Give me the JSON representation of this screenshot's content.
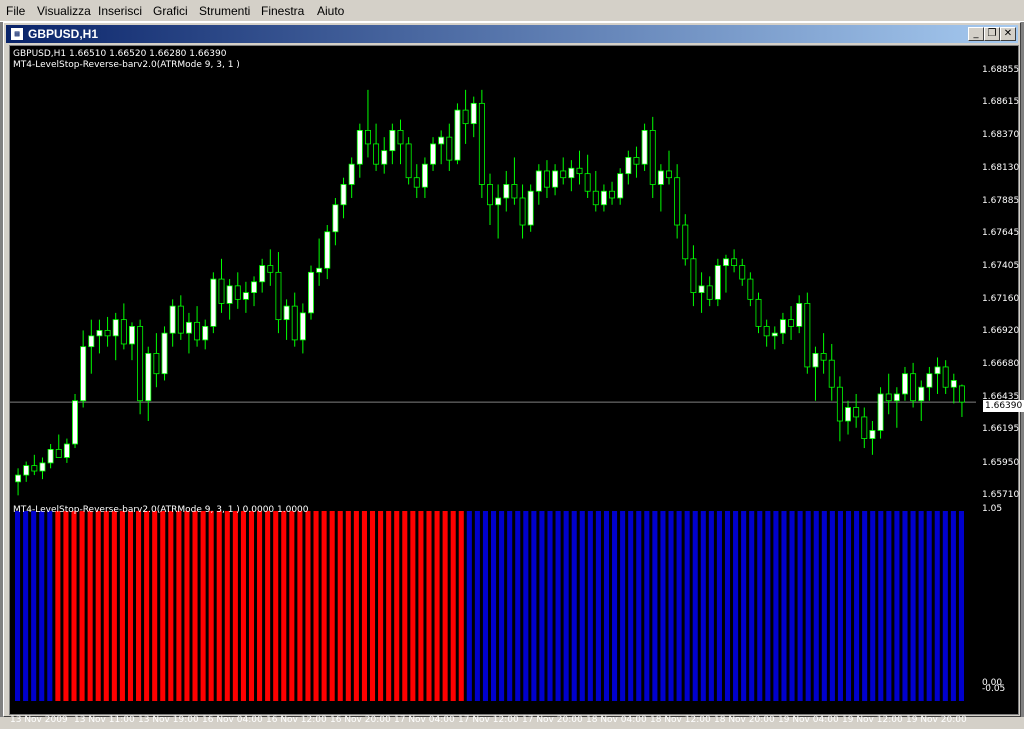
{
  "menu": {
    "items": [
      "File",
      "Visualizza",
      "Inserisci",
      "Grafici",
      "Strumenti",
      "Finestra",
      "Aiuto"
    ]
  },
  "window": {
    "title": "GBPUSD,H1",
    "icon": "chart-window-icon",
    "buttons": [
      "minimize-icon",
      "restore-icon",
      "close-icon"
    ]
  },
  "chart": {
    "symbol_info": "GBPUSD,H1  1.66510 1.66520 1.66280 1.66390",
    "indicator_label": "MT4-LevelStop-Reverse-barv2.0(ATRMode 9, 3, 1 )",
    "current_price": "1.66390",
    "price_ticks": [
      "1.68855",
      "1.68615",
      "1.68370",
      "1.68130",
      "1.67885",
      "1.67645",
      "1.67405",
      "1.67160",
      "1.66920",
      "1.66680",
      "1.66435",
      "1.66195",
      "1.65950",
      "1.65710"
    ],
    "time_ticks": [
      "13 Nov 2009",
      "13 Nov 11:00",
      "13 Nov 19:00",
      "16 Nov 04:00",
      "16 Nov 12:00",
      "16 Nov 20:00",
      "17 Nov 04:00",
      "17 Nov 12:00",
      "17 Nov 20:00",
      "18 Nov 04:00",
      "18 Nov 12:00",
      "18 Nov 20:00",
      "19 Nov 04:00",
      "19 Nov 12:00",
      "19 Nov 20:00"
    ],
    "colors": {
      "bull": "#ffffff",
      "wick": "#00ff00",
      "bear": "#000000",
      "grid_line": "#808080",
      "red_bar": "#ff0000",
      "blue_bar": "#0000cc"
    }
  },
  "indicator": {
    "label": "MT4-LevelStop-Reverse-barv2.0(ATRMode 9, 3, 1 ) 0.0000 1.0000",
    "axis_ticks": [
      "1.05",
      "0.00",
      "-0.05"
    ]
  },
  "chart_data": {
    "type": "candlestick",
    "symbol": "GBPUSD",
    "timeframe": "H1",
    "ylim": [
      1.6571,
      1.6898
    ],
    "last": 1.6639,
    "candles": [
      [
        1.658,
        1.659,
        1.657,
        1.6585
      ],
      [
        1.6585,
        1.6595,
        1.658,
        1.6592
      ],
      [
        1.6592,
        1.66,
        1.6585,
        1.6588
      ],
      [
        1.6588,
        1.6598,
        1.6582,
        1.6594
      ],
      [
        1.6594,
        1.6608,
        1.659,
        1.6604
      ],
      [
        1.6604,
        1.6615,
        1.66,
        1.6598
      ],
      [
        1.6598,
        1.6612,
        1.6594,
        1.6608
      ],
      [
        1.6608,
        1.6645,
        1.6605,
        1.664
      ],
      [
        1.664,
        1.6692,
        1.6635,
        1.668
      ],
      [
        1.668,
        1.67,
        1.666,
        1.6688
      ],
      [
        1.6688,
        1.67,
        1.6675,
        1.6692
      ],
      [
        1.6692,
        1.6702,
        1.668,
        1.6688
      ],
      [
        1.6688,
        1.6705,
        1.667,
        1.67
      ],
      [
        1.67,
        1.6712,
        1.6678,
        1.6682
      ],
      [
        1.6682,
        1.6698,
        1.667,
        1.6695
      ],
      [
        1.6695,
        1.67,
        1.663,
        1.664
      ],
      [
        1.664,
        1.668,
        1.6625,
        1.6675
      ],
      [
        1.6675,
        1.669,
        1.665,
        1.666
      ],
      [
        1.666,
        1.6695,
        1.6655,
        1.669
      ],
      [
        1.669,
        1.6715,
        1.668,
        1.671
      ],
      [
        1.671,
        1.6718,
        1.6685,
        1.669
      ],
      [
        1.669,
        1.6705,
        1.6675,
        1.6698
      ],
      [
        1.6698,
        1.671,
        1.668,
        1.6685
      ],
      [
        1.6685,
        1.67,
        1.6678,
        1.6695
      ],
      [
        1.6695,
        1.6735,
        1.669,
        1.673
      ],
      [
        1.673,
        1.6745,
        1.6705,
        1.6712
      ],
      [
        1.6712,
        1.673,
        1.67,
        1.6725
      ],
      [
        1.6725,
        1.6735,
        1.6708,
        1.6715
      ],
      [
        1.6715,
        1.6728,
        1.6705,
        1.672
      ],
      [
        1.672,
        1.6732,
        1.671,
        1.6728
      ],
      [
        1.6728,
        1.6745,
        1.672,
        1.674
      ],
      [
        1.674,
        1.6752,
        1.6725,
        1.6735
      ],
      [
        1.6735,
        1.675,
        1.669,
        1.67
      ],
      [
        1.67,
        1.6715,
        1.6685,
        1.671
      ],
      [
        1.671,
        1.672,
        1.668,
        1.6685
      ],
      [
        1.6685,
        1.6712,
        1.6675,
        1.6705
      ],
      [
        1.6705,
        1.674,
        1.67,
        1.6735
      ],
      [
        1.6735,
        1.676,
        1.6725,
        1.6738
      ],
      [
        1.6738,
        1.677,
        1.673,
        1.6765
      ],
      [
        1.6765,
        1.679,
        1.6755,
        1.6785
      ],
      [
        1.6785,
        1.6805,
        1.6775,
        1.68
      ],
      [
        1.68,
        1.682,
        1.679,
        1.6815
      ],
      [
        1.6815,
        1.6845,
        1.6805,
        1.684
      ],
      [
        1.684,
        1.687,
        1.682,
        1.683
      ],
      [
        1.683,
        1.6845,
        1.681,
        1.6815
      ],
      [
        1.6815,
        1.6835,
        1.6808,
        1.6825
      ],
      [
        1.6825,
        1.6845,
        1.6815,
        1.684
      ],
      [
        1.684,
        1.6848,
        1.6815,
        1.683
      ],
      [
        1.683,
        1.6835,
        1.68,
        1.6805
      ],
      [
        1.6805,
        1.6815,
        1.679,
        1.6798
      ],
      [
        1.6798,
        1.682,
        1.679,
        1.6815
      ],
      [
        1.6815,
        1.6835,
        1.681,
        1.683
      ],
      [
        1.683,
        1.684,
        1.6815,
        1.6835
      ],
      [
        1.6835,
        1.6845,
        1.681,
        1.6818
      ],
      [
        1.6818,
        1.686,
        1.6815,
        1.6855
      ],
      [
        1.6855,
        1.687,
        1.683,
        1.6845
      ],
      [
        1.6845,
        1.6865,
        1.6835,
        1.686
      ],
      [
        1.686,
        1.687,
        1.679,
        1.68
      ],
      [
        1.68,
        1.6808,
        1.677,
        1.6785
      ],
      [
        1.6785,
        1.68,
        1.676,
        1.679
      ],
      [
        1.679,
        1.681,
        1.678,
        1.68
      ],
      [
        1.68,
        1.682,
        1.6785,
        1.679
      ],
      [
        1.679,
        1.68,
        1.676,
        1.677
      ],
      [
        1.677,
        1.68,
        1.6765,
        1.6795
      ],
      [
        1.6795,
        1.6815,
        1.6785,
        1.681
      ],
      [
        1.681,
        1.6818,
        1.679,
        1.6798
      ],
      [
        1.6798,
        1.6815,
        1.6792,
        1.681
      ],
      [
        1.681,
        1.682,
        1.68,
        1.6805
      ],
      [
        1.6805,
        1.6818,
        1.6795,
        1.6812
      ],
      [
        1.6812,
        1.6825,
        1.68,
        1.6808
      ],
      [
        1.6808,
        1.6822,
        1.679,
        1.6795
      ],
      [
        1.6795,
        1.681,
        1.678,
        1.6785
      ],
      [
        1.6785,
        1.68,
        1.678,
        1.6795
      ],
      [
        1.6795,
        1.6802,
        1.6785,
        1.679
      ],
      [
        1.679,
        1.6812,
        1.6785,
        1.6808
      ],
      [
        1.6808,
        1.6825,
        1.68,
        1.682
      ],
      [
        1.682,
        1.6828,
        1.6805,
        1.6815
      ],
      [
        1.6815,
        1.6845,
        1.681,
        1.684
      ],
      [
        1.684,
        1.685,
        1.679,
        1.68
      ],
      [
        1.68,
        1.6815,
        1.678,
        1.681
      ],
      [
        1.681,
        1.6825,
        1.68,
        1.6805
      ],
      [
        1.6805,
        1.6815,
        1.676,
        1.677
      ],
      [
        1.677,
        1.6778,
        1.674,
        1.6745
      ],
      [
        1.6745,
        1.6755,
        1.671,
        1.672
      ],
      [
        1.672,
        1.6735,
        1.6705,
        1.6725
      ],
      [
        1.6725,
        1.6732,
        1.671,
        1.6715
      ],
      [
        1.6715,
        1.6745,
        1.671,
        1.674
      ],
      [
        1.674,
        1.6748,
        1.672,
        1.6745
      ],
      [
        1.6745,
        1.6752,
        1.6735,
        1.674
      ],
      [
        1.674,
        1.6745,
        1.6725,
        1.673
      ],
      [
        1.673,
        1.6735,
        1.671,
        1.6715
      ],
      [
        1.6715,
        1.672,
        1.669,
        1.6695
      ],
      [
        1.6695,
        1.67,
        1.668,
        1.6688
      ],
      [
        1.6688,
        1.6695,
        1.6678,
        1.669
      ],
      [
        1.669,
        1.6705,
        1.6682,
        1.67
      ],
      [
        1.67,
        1.671,
        1.6685,
        1.6695
      ],
      [
        1.6695,
        1.6718,
        1.669,
        1.6712
      ],
      [
        1.6712,
        1.672,
        1.666,
        1.6665
      ],
      [
        1.6665,
        1.668,
        1.664,
        1.6675
      ],
      [
        1.6675,
        1.669,
        1.666,
        1.667
      ],
      [
        1.667,
        1.6682,
        1.664,
        1.665
      ],
      [
        1.665,
        1.6658,
        1.661,
        1.6625
      ],
      [
        1.6625,
        1.664,
        1.6615,
        1.6635
      ],
      [
        1.6635,
        1.6645,
        1.662,
        1.6628
      ],
      [
        1.6628,
        1.6635,
        1.6605,
        1.6612
      ],
      [
        1.6612,
        1.6625,
        1.66,
        1.6618
      ],
      [
        1.6618,
        1.665,
        1.6612,
        1.6645
      ],
      [
        1.6645,
        1.666,
        1.663,
        1.664
      ],
      [
        1.664,
        1.665,
        1.662,
        1.6645
      ],
      [
        1.6645,
        1.6665,
        1.664,
        1.666
      ],
      [
        1.666,
        1.6668,
        1.6635,
        1.664
      ],
      [
        1.664,
        1.6655,
        1.6625,
        1.665
      ],
      [
        1.665,
        1.6665,
        1.664,
        1.666
      ],
      [
        1.666,
        1.6672,
        1.6645,
        1.6665
      ],
      [
        1.6665,
        1.667,
        1.6645,
        1.665
      ],
      [
        1.665,
        1.666,
        1.6638,
        1.6655
      ],
      [
        1.6651,
        1.6652,
        1.6628,
        1.6639
      ]
    ],
    "indicator_bars": {
      "blue_before": 5,
      "red": 51,
      "blue_after": 62,
      "value": 1.0
    }
  }
}
